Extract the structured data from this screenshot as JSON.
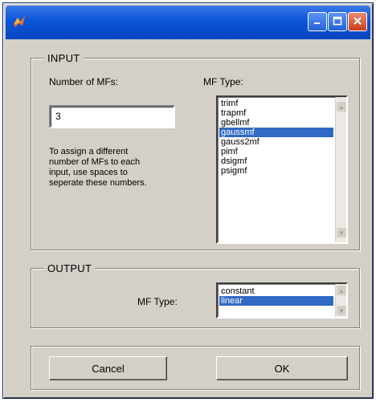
{
  "window": {
    "icon": "matlab-icon",
    "title_buttons": [
      "minimize-icon",
      "maximize-icon",
      "close-icon"
    ]
  },
  "input": {
    "legend": "INPUT",
    "num_mfs_label": "Number of MFs:",
    "num_mfs_value": "3",
    "help_text": [
      "To assign a different",
      "number of MFs to each",
      "input, use spaces to",
      "seperate these numbers."
    ],
    "mf_type_label": "MF Type:",
    "mf_types": [
      "trimf",
      "trapmf",
      "gbellmf",
      "gaussmf",
      "gauss2mf",
      "pimf",
      "dsigmf",
      "psigmf"
    ],
    "selected_mf_type": "gaussmf"
  },
  "output": {
    "legend": "OUTPUT",
    "mf_type_label": "MF Type:",
    "mf_types": [
      "constant",
      "linear"
    ],
    "selected_mf_type": "linear"
  },
  "buttons": {
    "cancel": "Cancel",
    "ok": "OK"
  }
}
